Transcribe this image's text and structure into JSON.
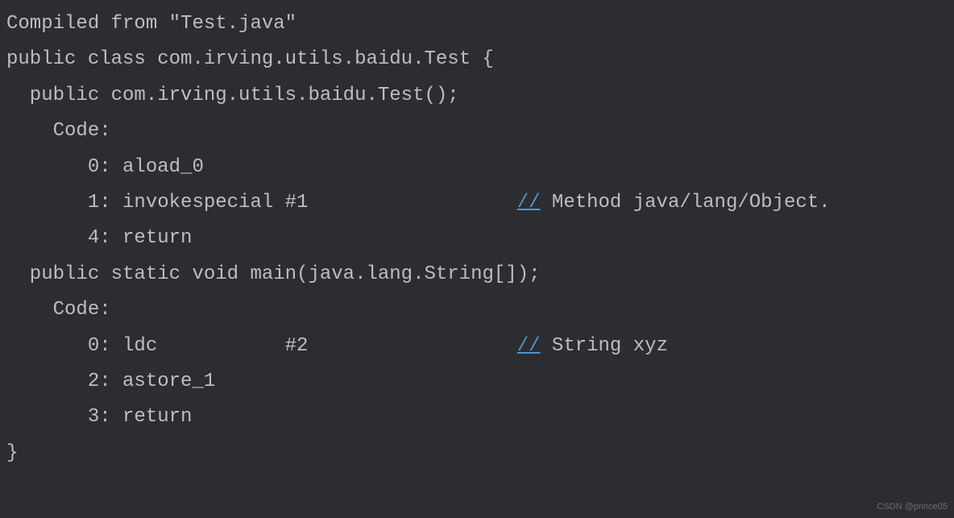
{
  "lines": {
    "l0": "Compiled from \"Test.java\"",
    "l1": "public class com.irving.utils.baidu.Test {",
    "l2": "  public com.irving.utils.baidu.Test();",
    "l3": "    Code:",
    "l4": "       0: aload_0",
    "l5_pre": "       1: invokespecial #1                  ",
    "l5_slash": "//",
    "l5_comment": " Method java/lang/Object.",
    "l6": "       4: return",
    "l7": "",
    "l8": "  public static void main(java.lang.String[]);",
    "l9": "    Code:",
    "l10_pre": "       0: ldc           #2                  ",
    "l10_slash": "//",
    "l10_comment": " String xyz",
    "l11": "       2: astore_1",
    "l12": "       3: return",
    "l13": "}"
  },
  "watermark": "CSDN @prince05"
}
